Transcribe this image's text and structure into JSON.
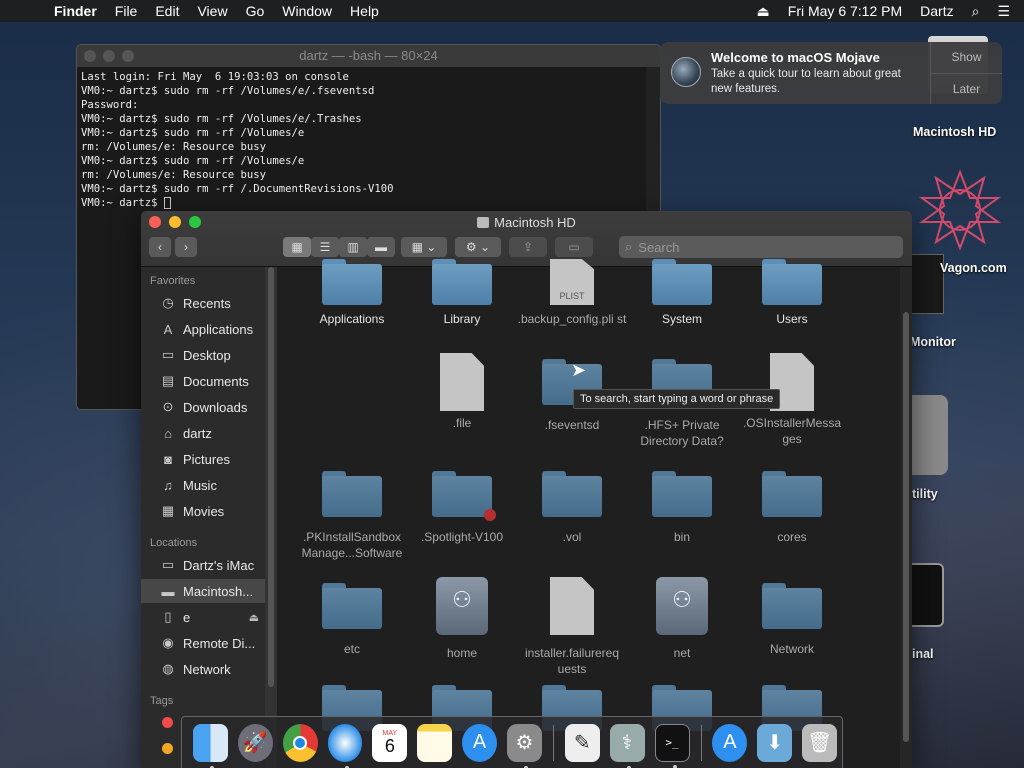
{
  "menubar": {
    "apple": "",
    "app": "Finder",
    "menus": [
      "File",
      "Edit",
      "View",
      "Go",
      "Window",
      "Help"
    ],
    "date": "Fri May 6  7:12 PM",
    "user": "Dartz"
  },
  "terminal": {
    "title": "dartz — -bash — 80×24",
    "lines": [
      "Last login: Fri May  6 19:03:03 on console",
      "VM0:~ dartz$ sudo rm -rf /Volumes/e/.fseventsd",
      "Password:",
      "VM0:~ dartz$ sudo rm -rf /Volumes/e/.Trashes",
      "VM0:~ dartz$ sudo rm -rf /Volumes/e",
      "rm: /Volumes/e: Resource busy",
      "VM0:~ dartz$ sudo rm -rf /Volumes/e",
      "rm: /Volumes/e: Resource busy",
      "VM0:~ dartz$ sudo rm -rf /.DocumentRevisions-V100",
      "VM0:~ dartz$ "
    ]
  },
  "notification": {
    "title": "Welcome to macOS Mojave",
    "body": "Take a quick tour to learn about great new features.",
    "show": "Show",
    "later": "Later"
  },
  "desktop": {
    "labels": [
      "Macintosh HD",
      "Vagon.com",
      "Monitor",
      "tility",
      "inal"
    ]
  },
  "finder": {
    "title": "Macintosh HD",
    "search_placeholder": "Search",
    "sidebar": {
      "favorites_header": "Favorites",
      "favorites": [
        "Recents",
        "Applications",
        "Desktop",
        "Documents",
        "Downloads",
        "dartz",
        "Pictures",
        "Music",
        "Movies"
      ],
      "locations_header": "Locations",
      "locations": [
        "Dartz's iMac",
        "Macintosh...",
        "e",
        "Remote Di...",
        "Network"
      ],
      "tags_header": "Tags"
    },
    "items": [
      {
        "name": "Applications"
      },
      {
        "name": "Library"
      },
      {
        "name": ".backup_config.pli st"
      },
      {
        "name": "System"
      },
      {
        "name": "Users"
      },
      {
        "name": ".file"
      },
      {
        "name": ".fseventsd"
      },
      {
        "name": ".HFS+ Private Directory Data?"
      },
      {
        "name": ".OSInstallerMessa ges"
      },
      {
        "name": ".PKInstallSandbox Manage...Software"
      },
      {
        "name": ".Spotlight-V100"
      },
      {
        "name": ".vol"
      },
      {
        "name": "bin"
      },
      {
        "name": "cores"
      },
      {
        "name": "etc"
      },
      {
        "name": "home"
      },
      {
        "name": "installer.failurereq uests"
      },
      {
        "name": "net"
      },
      {
        "name": "Network"
      }
    ],
    "plist_badge": "PLIST",
    "tooltip": "To search, start typing a word or phrase"
  },
  "dock": {
    "apps": [
      "Finder",
      "Launchpad",
      "Chrome",
      "Safari",
      "Calendar",
      "Notes",
      "App Store",
      "System Preferences",
      "TextEdit",
      "Disk Utility",
      "Terminal",
      "App Store Downloads",
      "Downloads",
      "Trash"
    ],
    "calendar_month": "MAY",
    "calendar_day": "6"
  }
}
